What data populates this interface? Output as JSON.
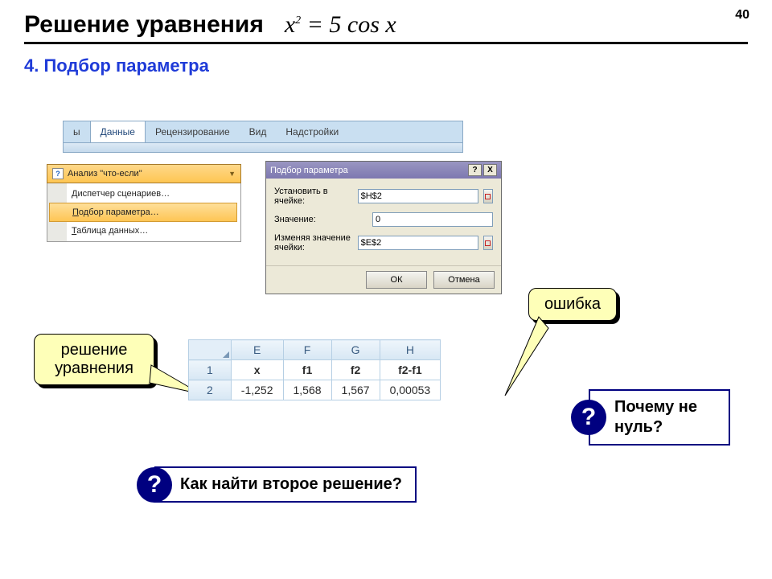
{
  "page_number": "40",
  "title": "Решение уравнения",
  "formula_html": "x² = 5 cos x",
  "subtitle": "4. Подбор параметра",
  "ribbon": {
    "tab_cut": "ы",
    "tabs": [
      "Данные",
      "Рецензирование",
      "Вид",
      "Надстройки"
    ]
  },
  "whatif": {
    "button": "Анализ \"что-если\"",
    "items": [
      {
        "text": "Диспетчер сценариев…",
        "selected": false,
        "u": "Д"
      },
      {
        "text": "Подбор параметра…",
        "selected": true,
        "u": "П"
      },
      {
        "text": "Таблица данных…",
        "selected": false,
        "u": "Т"
      }
    ]
  },
  "dialog": {
    "title": "Подбор параметра",
    "help": "?",
    "close": "X",
    "row1_label": "Установить в ячейке:",
    "row1_value": "$H$2",
    "row2_label": "Значение:",
    "row2_value": "0",
    "row3_label": "Изменяя значение ячейки:",
    "row3_value": "$E$2",
    "ok": "ОК",
    "cancel": "Отмена"
  },
  "callouts": {
    "solution": "решение уравнения",
    "error": "ошибка"
  },
  "sheet": {
    "cols": [
      "E",
      "F",
      "G",
      "H"
    ],
    "rowhdrs": [
      "1",
      "2"
    ],
    "headers": [
      "x",
      "f1",
      "f2",
      "f2-f1"
    ],
    "values": [
      "-1,252",
      "1,568",
      "1,567",
      "0,00053"
    ]
  },
  "q1": "Почему не нуль?",
  "q2": "Как найти второе решение?",
  "qmark": "?"
}
